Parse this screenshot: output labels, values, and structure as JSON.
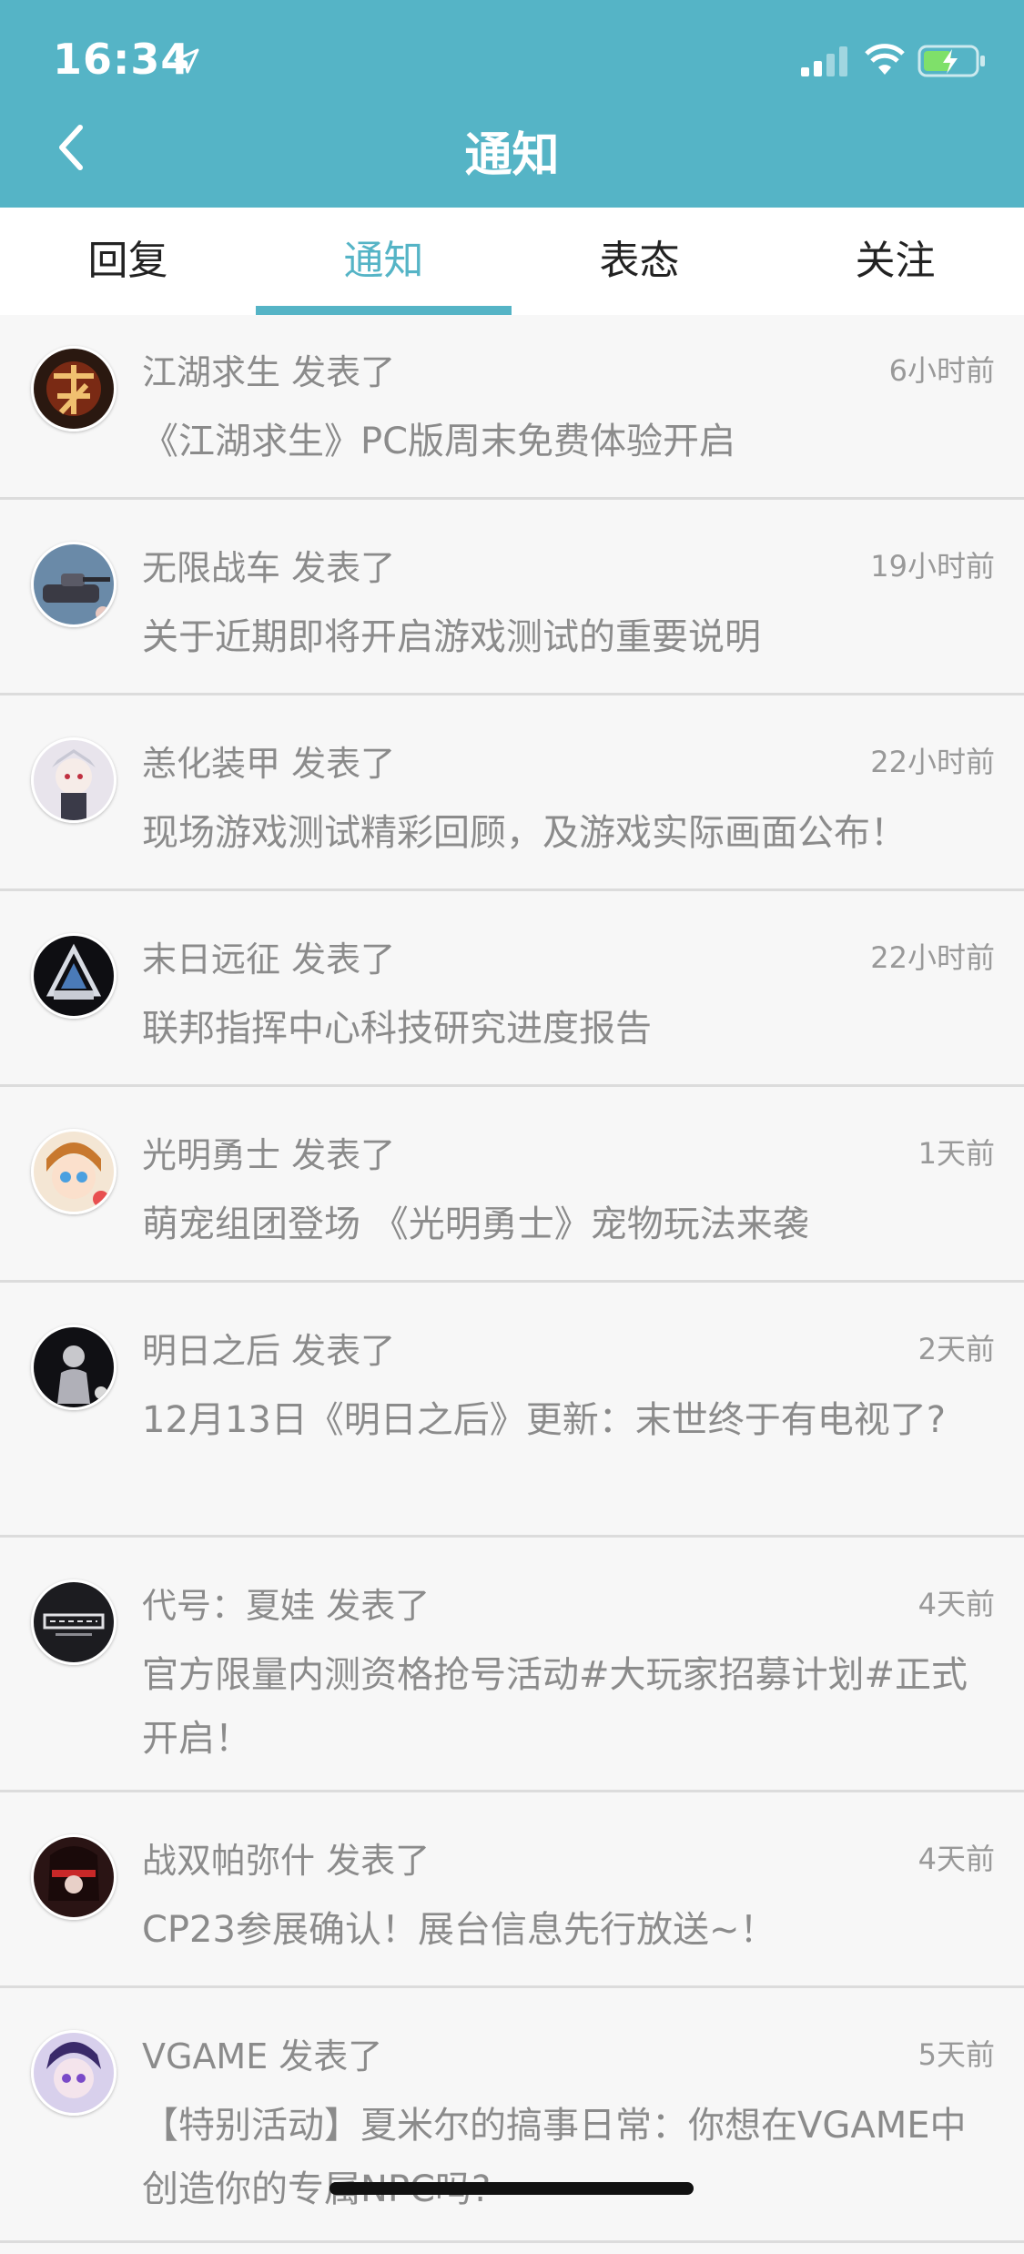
{
  "status_bar": {
    "time": "16:34"
  },
  "header": {
    "title": "通知"
  },
  "tabs": [
    {
      "label": "回复",
      "active": false
    },
    {
      "label": "通知",
      "active": true
    },
    {
      "label": "表态",
      "active": false
    },
    {
      "label": "关注",
      "active": false
    }
  ],
  "colors": {
    "accent": "#55b4c6",
    "muted_text": "#8b8b8b"
  },
  "notifications": [
    {
      "title": "江湖求生 发表了",
      "time": "6小时前",
      "body": "《江湖求生》PC版周末免费体验开启",
      "avatar": "jianghu-avatar"
    },
    {
      "title": "无限战车 发表了",
      "time": "19小时前",
      "body": "关于近期即将开启游戏测试的重要说明",
      "avatar": "tank-avatar"
    },
    {
      "title": "恙化装甲 发表了",
      "time": "22小时前",
      "body": "现场游戏测试精彩回顾，及游戏实际画面公布！",
      "avatar": "armor-girl-avatar"
    },
    {
      "title": "末日远征 发表了",
      "time": "22小时前",
      "body": "联邦指挥中心科技研究进度报告",
      "avatar": "amg-avatar"
    },
    {
      "title": "光明勇士 发表了",
      "time": "1天前",
      "body": "萌宠组团登场 《光明勇士》宠物玩法来袭",
      "avatar": "hero-avatar"
    },
    {
      "title": "明日之后 发表了",
      "time": "2天前",
      "body": "12月13日《明日之后》更新：末世终于有电视了?",
      "avatar": "tomorrow-avatar"
    },
    {
      "title": "代号：夏娃 发表了",
      "time": "4天前",
      "body": "官方限量内测资格抢号活动#大玩家招募计划#正式开启！",
      "avatar": "eve-avatar"
    },
    {
      "title": "战双帕弥什 发表了",
      "time": "4天前",
      "body": "CP23参展确认！展台信息先行放送~！",
      "avatar": "punishing-avatar"
    },
    {
      "title": "VGAME 发表了",
      "time": "5天前",
      "body": "【特别活动】夏米尔的搞事日常：你想在VGAME中创造你的专属NPC吗?",
      "avatar": "vgame-avatar"
    }
  ]
}
